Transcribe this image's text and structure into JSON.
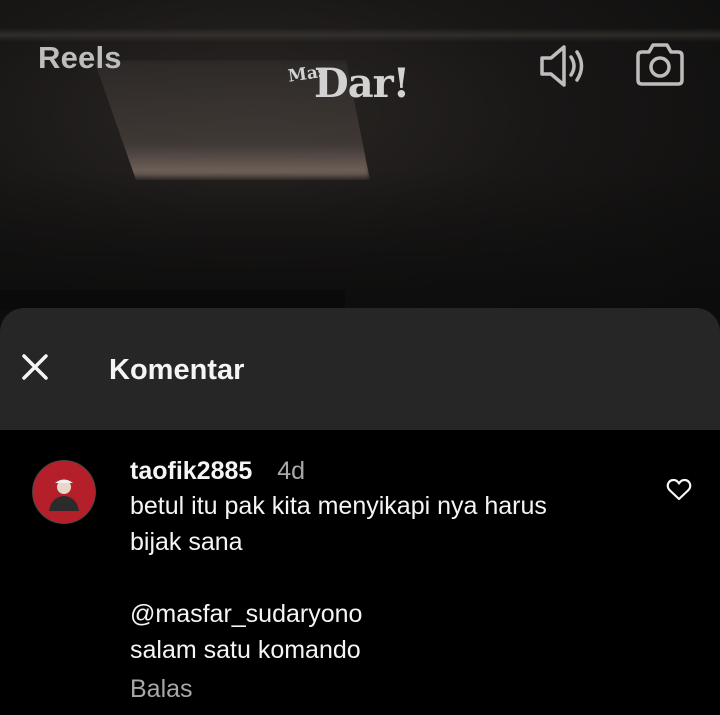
{
  "header": {
    "title": "Reels",
    "logo_small": "Mas",
    "logo_main": "Dar!",
    "sound_icon": "speaker-icon",
    "camera_icon": "camera-icon"
  },
  "sheet": {
    "close_icon": "close-icon",
    "title": "Komentar"
  },
  "comments": [
    {
      "username": "taofik2885",
      "age": "4d",
      "lines": [
        "betul itu pak kita menyikapi nya harus",
        "bijak sana",
        "",
        "@masfar_sudaryono",
        "salam satu komando"
      ],
      "reply_label": "Balas",
      "like_icon": "heart-icon"
    }
  ]
}
